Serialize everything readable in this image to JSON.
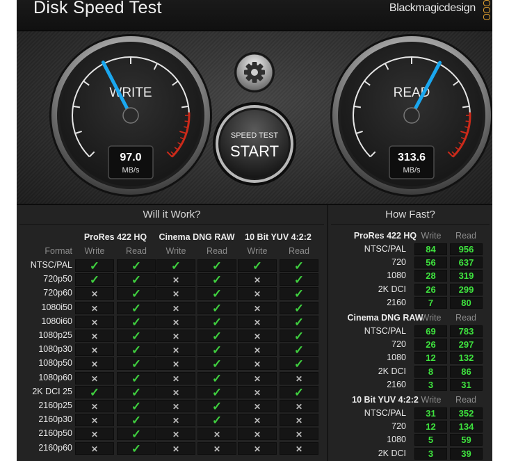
{
  "app": {
    "title": "Disk Speed Test",
    "brand": "Blackmagicdesign"
  },
  "colors": {
    "needle": "#1aa7ef",
    "ok": "#3fcf3f",
    "speed_value": "#3ee23e",
    "red_zone": "#cc2a1a",
    "brand_mark": "#e0a030"
  },
  "gauges": {
    "write": {
      "label": "WRITE",
      "value": "97.0",
      "unit": "MB/s"
    },
    "read": {
      "label": "READ",
      "value": "313.6",
      "unit": "MB/s"
    }
  },
  "settings_icon": "gear-icon",
  "start_button": {
    "top": "SPEED TEST",
    "main": "START"
  },
  "will_it_work": {
    "title": "Will it Work?",
    "format_label": "Format",
    "groups": [
      "ProRes 422 HQ",
      "Cinema DNG RAW",
      "10 Bit YUV 4:2:2"
    ],
    "sub": [
      "Write",
      "Read"
    ],
    "rows": [
      {
        "format": "NTSC/PAL",
        "cells": [
          1,
          1,
          1,
          1,
          1,
          1
        ]
      },
      {
        "format": "720p50",
        "cells": [
          1,
          1,
          0,
          1,
          0,
          1
        ]
      },
      {
        "format": "720p60",
        "cells": [
          0,
          1,
          0,
          1,
          0,
          1
        ]
      },
      {
        "format": "1080i50",
        "cells": [
          0,
          1,
          0,
          1,
          0,
          1
        ]
      },
      {
        "format": "1080i60",
        "cells": [
          0,
          1,
          0,
          1,
          0,
          1
        ]
      },
      {
        "format": "1080p25",
        "cells": [
          0,
          1,
          0,
          1,
          0,
          1
        ]
      },
      {
        "format": "1080p30",
        "cells": [
          0,
          1,
          0,
          1,
          0,
          1
        ]
      },
      {
        "format": "1080p50",
        "cells": [
          0,
          1,
          0,
          1,
          0,
          1
        ]
      },
      {
        "format": "1080p60",
        "cells": [
          0,
          1,
          0,
          1,
          0,
          0
        ]
      },
      {
        "format": "2K DCI 25",
        "cells": [
          1,
          1,
          0,
          1,
          0,
          1
        ]
      },
      {
        "format": "2160p25",
        "cells": [
          0,
          1,
          0,
          1,
          0,
          0
        ]
      },
      {
        "format": "2160p30",
        "cells": [
          0,
          1,
          0,
          1,
          0,
          0
        ]
      },
      {
        "format": "2160p50",
        "cells": [
          0,
          1,
          0,
          0,
          0,
          0
        ]
      },
      {
        "format": "2160p60",
        "cells": [
          0,
          1,
          0,
          0,
          0,
          0
        ]
      }
    ]
  },
  "how_fast": {
    "title": "How Fast?",
    "sub": [
      "Write",
      "Read"
    ],
    "groups": [
      {
        "name": "ProRes 422 HQ",
        "rows": [
          {
            "format": "NTSC/PAL",
            "write": "84",
            "read": "956"
          },
          {
            "format": "720",
            "write": "56",
            "read": "637"
          },
          {
            "format": "1080",
            "write": "28",
            "read": "319"
          },
          {
            "format": "2K DCI",
            "write": "26",
            "read": "299"
          },
          {
            "format": "2160",
            "write": "7",
            "read": "80"
          }
        ]
      },
      {
        "name": "Cinema DNG RAW",
        "rows": [
          {
            "format": "NTSC/PAL",
            "write": "69",
            "read": "783"
          },
          {
            "format": "720",
            "write": "26",
            "read": "297"
          },
          {
            "format": "1080",
            "write": "12",
            "read": "132"
          },
          {
            "format": "2K DCI",
            "write": "8",
            "read": "86"
          },
          {
            "format": "2160",
            "write": "3",
            "read": "31"
          }
        ]
      },
      {
        "name": "10 Bit YUV 4:2:2",
        "rows": [
          {
            "format": "NTSC/PAL",
            "write": "31",
            "read": "352"
          },
          {
            "format": "720",
            "write": "12",
            "read": "134"
          },
          {
            "format": "1080",
            "write": "5",
            "read": "59"
          },
          {
            "format": "2K DCI",
            "write": "3",
            "read": "39"
          }
        ]
      }
    ]
  }
}
